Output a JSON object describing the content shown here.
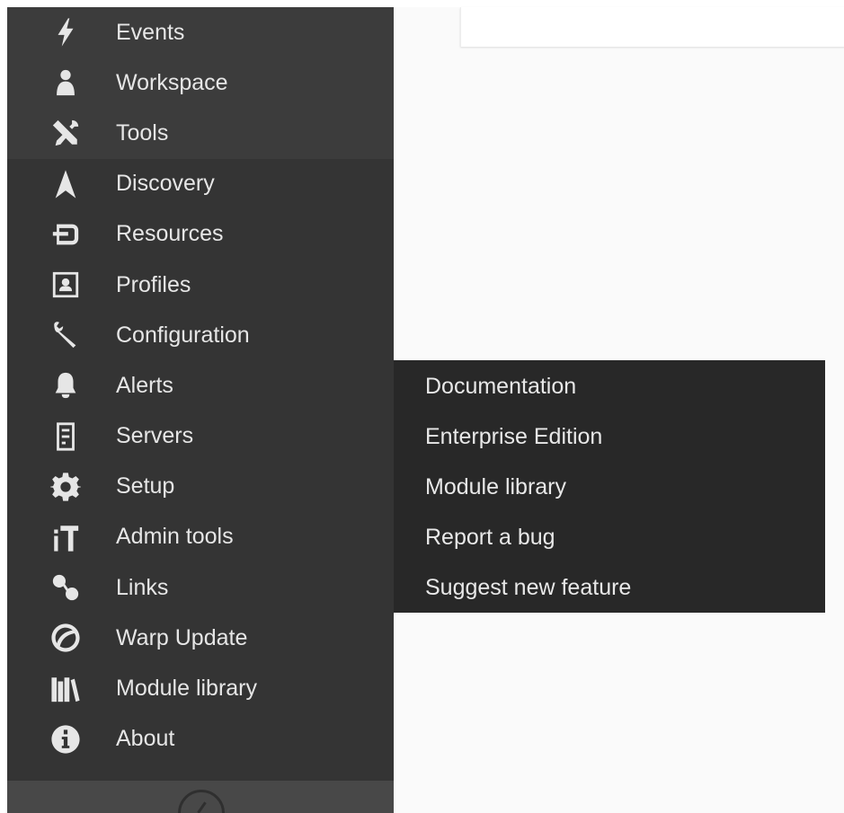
{
  "sidebar": {
    "items": [
      {
        "label": "Events",
        "icon": "lightning-icon"
      },
      {
        "label": "Workspace",
        "icon": "user-icon"
      },
      {
        "label": "Tools",
        "icon": "tools-icon"
      },
      {
        "label": "Discovery",
        "icon": "discovery-icon"
      },
      {
        "label": "Resources",
        "icon": "resources-icon"
      },
      {
        "label": "Profiles",
        "icon": "profile-icon"
      },
      {
        "label": "Configuration",
        "icon": "wrench-icon"
      },
      {
        "label": "Alerts",
        "icon": "bell-icon"
      },
      {
        "label": "Servers",
        "icon": "server-icon"
      },
      {
        "label": "Setup",
        "icon": "gear-icon"
      },
      {
        "label": "Admin tools",
        "icon": "admin-tools-icon"
      },
      {
        "label": "Links",
        "icon": "link-icon"
      },
      {
        "label": "Warp Update",
        "icon": "warp-update-icon"
      },
      {
        "label": "Module library",
        "icon": "library-icon"
      },
      {
        "label": "About",
        "icon": "info-icon"
      }
    ]
  },
  "submenu": {
    "items": [
      {
        "label": "Documentation"
      },
      {
        "label": "Enterprise Edition"
      },
      {
        "label": "Module library"
      },
      {
        "label": "Report a bug"
      },
      {
        "label": "Suggest new feature"
      }
    ]
  },
  "colors": {
    "sidebar_bg": "#343434",
    "sidebar_group_bg": "#3c3c3c",
    "submenu_bg": "#282828",
    "text": "#e6e6e6",
    "page_bg": "#fafafa"
  }
}
